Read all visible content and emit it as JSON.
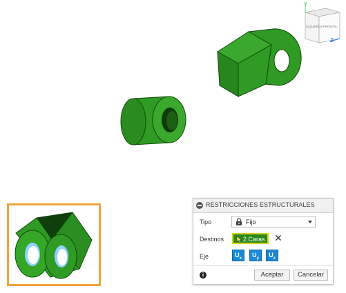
{
  "viewcube": {
    "face_left_label": "IZQUIERDA",
    "face_front_label": "FRONTAL",
    "axis_y": "Y",
    "axis_z": "Z"
  },
  "panel": {
    "title": "RESTRICCIONES ESTRUCTURALES",
    "tipo_label": "Tipo",
    "tipo_value": "Fijo",
    "destinos_label": "Destinos",
    "destinos_value": "2 Caras",
    "eje_label": "Eje",
    "axes": [
      {
        "main": "U",
        "sub": "x"
      },
      {
        "main": "U",
        "sub": "y"
      },
      {
        "main": "U",
        "sub": "z"
      }
    ],
    "info_symbol": "i",
    "accept_label": "Aceptar",
    "cancel_label": "Cancelar"
  },
  "colors": {
    "model_green": "#2f9a24",
    "model_dark": "#1d6a14",
    "selection_green": "#2b8a1d",
    "selection_border": "#d9d31b",
    "axis_blue": "#1a8ad4",
    "thumbnail_border": "#f0a43a"
  },
  "icons": [
    "lock-icon",
    "cursor-icon",
    "clear-icon",
    "info-icon",
    "dropdown-arrow-icon",
    "collapse-icon"
  ]
}
